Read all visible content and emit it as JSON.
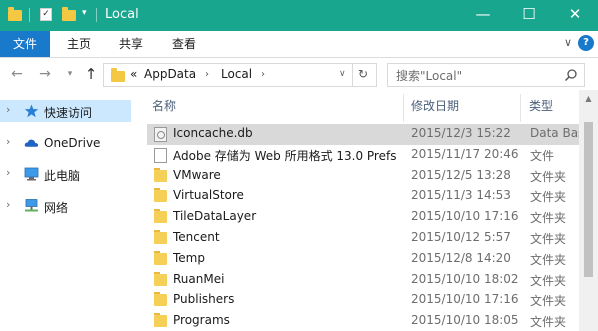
{
  "window": {
    "title": "Local"
  },
  "ribbon": {
    "tabs": [
      "文件",
      "主页",
      "共享",
      "查看"
    ],
    "help": "?"
  },
  "address": {
    "overflow": "«",
    "crumbs": [
      "AppData",
      "Local"
    ]
  },
  "search": {
    "placeholder": "搜索\"Local\""
  },
  "nav": {
    "items": [
      {
        "label": "快速访问",
        "icon": "star-icon"
      },
      {
        "label": "OneDrive",
        "icon": "cloud-icon"
      },
      {
        "label": "此电脑",
        "icon": "computer-icon"
      },
      {
        "label": "网络",
        "icon": "network-icon"
      }
    ]
  },
  "columns": {
    "name": "名称",
    "date": "修改日期",
    "type": "类型"
  },
  "files": [
    {
      "name": "Iconcache.db",
      "date": "2015/12/3 15:22",
      "type": "Data Bas",
      "icon": "db-file-icon"
    },
    {
      "name": "Adobe 存储为 Web 所用格式 13.0 Prefs",
      "date": "2015/11/17 20:46",
      "type": "文件",
      "icon": "file-icon"
    },
    {
      "name": "VMware",
      "date": "2015/12/5 13:28",
      "type": "文件夹",
      "icon": "folder-icon"
    },
    {
      "name": "VirtualStore",
      "date": "2015/11/3 14:53",
      "type": "文件夹",
      "icon": "folder-icon"
    },
    {
      "name": "TileDataLayer",
      "date": "2015/10/10 17:16",
      "type": "文件夹",
      "icon": "folder-icon"
    },
    {
      "name": "Tencent",
      "date": "2015/10/12 5:57",
      "type": "文件夹",
      "icon": "folder-icon"
    },
    {
      "name": "Temp",
      "date": "2015/12/8 14:20",
      "type": "文件夹",
      "icon": "folder-icon"
    },
    {
      "name": "RuanMei",
      "date": "2015/10/10 18:02",
      "type": "文件夹",
      "icon": "folder-icon"
    },
    {
      "name": "Publishers",
      "date": "2015/10/10 17:16",
      "type": "文件夹",
      "icon": "folder-icon"
    },
    {
      "name": "Programs",
      "date": "2015/10/10 18:05",
      "type": "文件夹",
      "icon": "folder-icon"
    }
  ],
  "colors": {
    "titlebar": "#19a68f",
    "file_tab": "#1979ca",
    "nav_selected": "#cce8ff",
    "row_selected": "#d9d9d9"
  }
}
